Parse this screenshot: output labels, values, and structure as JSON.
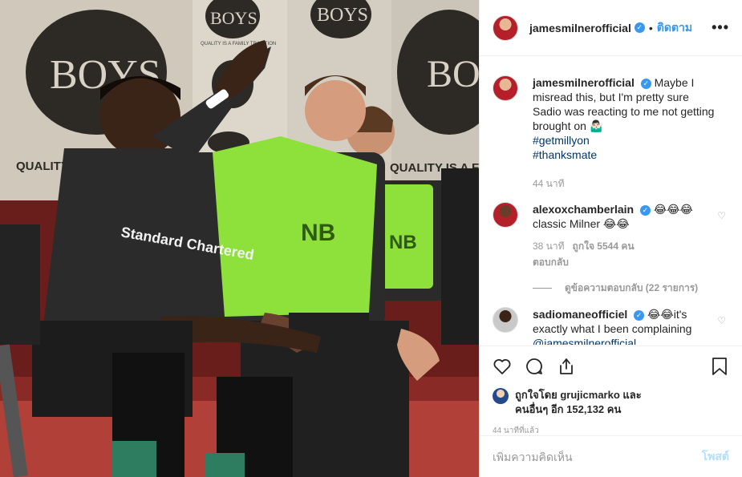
{
  "header": {
    "username": "jamesmilnerofficial",
    "follow_label": "ติดตาม",
    "dot": "•",
    "more_label": "•••"
  },
  "caption": {
    "username": "jamesmilnerofficial",
    "text": "Maybe I misread this, but I'm pretty sure Sadio was reacting to me not getting brought on 🤷🏻‍♂️",
    "tags": [
      "#getmillyon",
      "#thanksmate"
    ],
    "time": "44 นาที"
  },
  "comments": [
    {
      "username": "alexoxchamberlain",
      "emoji": "😂😂😂",
      "text": "classic Milner 😂😂",
      "time": "38 นาที",
      "likes": "ถูกใจ 5544 คน",
      "reply_label": "ตอบกลับ",
      "view_replies": "ดูข้อความตอบกลับ (22 รายการ)"
    },
    {
      "username": "sadiomaneofficiel",
      "text": "😂😂it's exactly what I been complaining",
      "mention": "@jamesmilnerofficial"
    }
  ],
  "likes": {
    "line1": "ถูกใจโดย grujicmarko และ",
    "line2": "คนอื่นๆ อีก 152,132 คน"
  },
  "time_ago": "44 นาทีที่แล้ว",
  "add_comment": {
    "placeholder": "เพิ่มความคิดเห็น",
    "post_label": "โพสต์"
  },
  "photo": {
    "sign_brand": "BOYS",
    "sign_tagline": "QUALITY IS A FAMILY TRADITION",
    "sign_quality": "QUALITY IS A FAM",
    "sign_quality_left": "QUALITY",
    "sponsor": "Standard Chartered",
    "bib_brand": "NB"
  },
  "colors": {
    "accent": "#3897f0",
    "link": "#003569",
    "bib": "#8ee03a",
    "kit": "#2b2b2b"
  }
}
